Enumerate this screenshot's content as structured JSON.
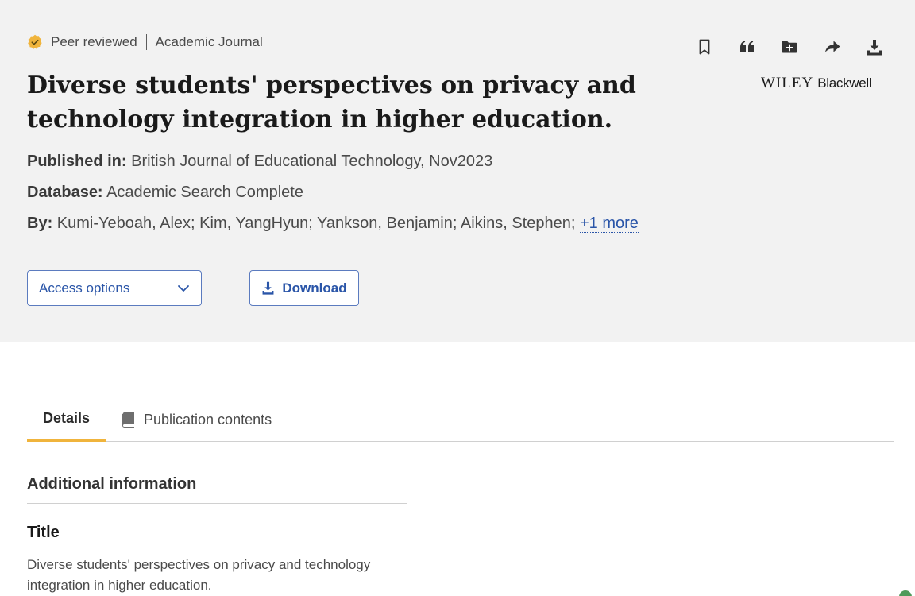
{
  "meta": {
    "peer_reviewed": "Peer reviewed",
    "source_type": "Academic Journal"
  },
  "toolbar": {
    "icons": [
      "bookmark-icon",
      "quote-icon",
      "add-to-folder-icon",
      "share-icon",
      "download-icon"
    ]
  },
  "publisher": {
    "name_part1": "WILEY",
    "name_part2": "Blackwell"
  },
  "article": {
    "title": "Diverse students' perspectives on privacy and technology integration in higher education.",
    "published_label": "Published in:",
    "published_value": "British Journal of Educational Technology, Nov2023",
    "database_label": "Database:",
    "database_value": "Academic Search Complete",
    "by_label": "By:",
    "authors": "Kumi-Yeboah, Alex; Kim, YangHyun; Yankson, Benjamin; Aikins, Stephen;",
    "more_authors": "+1 more"
  },
  "actions": {
    "access_options": "Access options",
    "download": "Download"
  },
  "tabs": [
    {
      "label": "Details",
      "active": true
    },
    {
      "label": "Publication contents",
      "active": false
    }
  ],
  "details": {
    "section_heading": "Additional information",
    "title_label": "Title",
    "title_value": "Diverse students' perspectives on privacy and technology integration in higher education."
  },
  "colors": {
    "accent": "#f0b43c",
    "link": "#2a55a8",
    "header_bg": "#f2f2f2",
    "badge": "#f0b43c"
  }
}
